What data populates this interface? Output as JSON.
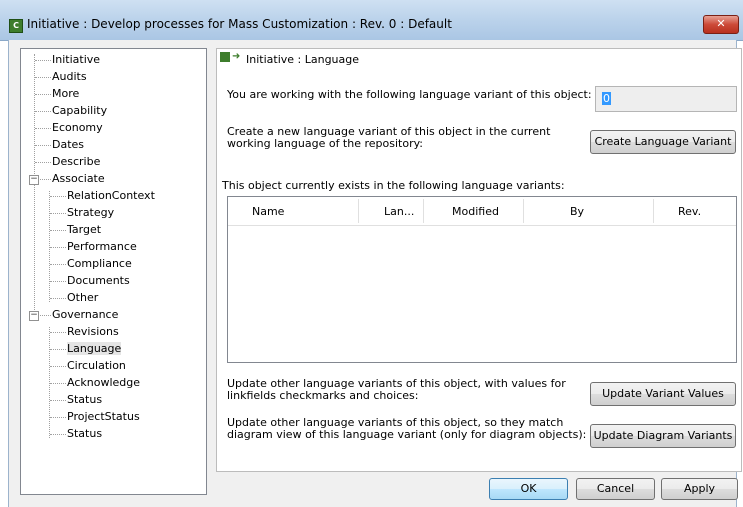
{
  "window": {
    "title": "Initiative : Develop processes for Mass Customization : Rev. 0  : Default",
    "icon": "C",
    "close_glyph": "✕"
  },
  "tree": {
    "items": [
      {
        "label": "Initiative",
        "level": 0
      },
      {
        "label": "Audits",
        "level": 0
      },
      {
        "label": "More",
        "level": 0
      },
      {
        "label": "Capability",
        "level": 0
      },
      {
        "label": "Economy",
        "level": 0
      },
      {
        "label": "Dates",
        "level": 0
      },
      {
        "label": "Describe",
        "level": 0
      },
      {
        "label": "Associate",
        "level": 0,
        "expanded": true
      },
      {
        "label": "RelationContext",
        "level": 1
      },
      {
        "label": "Strategy",
        "level": 1
      },
      {
        "label": "Target",
        "level": 1
      },
      {
        "label": "Performance",
        "level": 1
      },
      {
        "label": "Compliance",
        "level": 1
      },
      {
        "label": "Documents",
        "level": 1
      },
      {
        "label": "Other",
        "level": 1
      },
      {
        "label": "Governance",
        "level": 0,
        "expanded": true
      },
      {
        "label": "Revisions",
        "level": 1
      },
      {
        "label": "Language",
        "level": 1,
        "selected": true
      },
      {
        "label": "Circulation",
        "level": 1
      },
      {
        "label": "Acknowledge",
        "level": 1
      },
      {
        "label": "Status",
        "level": 1
      },
      {
        "label": "ProjectStatus",
        "level": 1
      },
      {
        "label": "Status",
        "level": 1
      }
    ],
    "expand_glyph": "−"
  },
  "panel": {
    "header": "Initiative : Language",
    "working_text": "You are working with the following language variant of this object:",
    "working_value": "0",
    "create_text_1": "Create a new language variant of this object in the current",
    "create_text_2": "working language of the repository:",
    "create_button": "Create Language Variant",
    "exists_text": "This object currently exists in the following language variants:",
    "columns": [
      "Name",
      "Lan...",
      "Modified",
      "By",
      "Rev."
    ],
    "update_values_text_1": "Update other language variants of this object, with values for",
    "update_values_text_2": "linkfields checkmarks and choices:",
    "update_values_button": "Update Variant Values",
    "update_diagram_text_1": "Update other language variants of this object, so they match",
    "update_diagram_text_2": "diagram view of this language variant (only for diagram objects):",
    "update_diagram_button": "Update Diagram Variants"
  },
  "footer": {
    "ok": "OK",
    "cancel": "Cancel",
    "apply": "Apply"
  },
  "colors": {
    "accent": "#3e7d2c",
    "close": "#cc4a38",
    "selection": "#3399ff"
  }
}
